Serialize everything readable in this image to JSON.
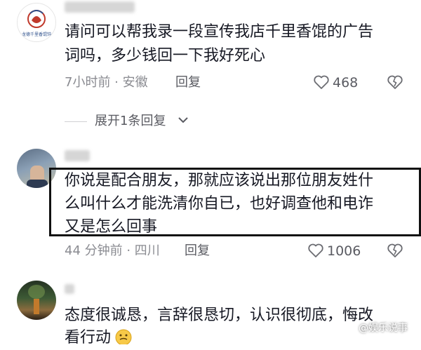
{
  "comments": [
    {
      "text_line1": "请问可以帮我录一段宣传我店千里香馄的广告",
      "text_line2": "词吗，多少钱回一下我好死心",
      "time": "7小时前 · 安徽",
      "reply": "回复",
      "likes": "468",
      "avatar_text": "龙德千里香馄饨"
    },
    {
      "text_line1": "你说是配合朋友，那就应该说出那位朋友姓什",
      "text_line2": "么叫什么才能洗清你自已，也好调查他和电诈",
      "text_line3": "又是怎么回事",
      "time": "44 分钟前 · 四川",
      "reply": "回复",
      "likes": "1006"
    },
    {
      "text_line1": "态度很诚恳，言辞很恳切，认识很彻底，悔改",
      "text_line2": "看行动"
    }
  ],
  "expand_replies": "展开1条回复",
  "watermark": "@娱乐说事"
}
